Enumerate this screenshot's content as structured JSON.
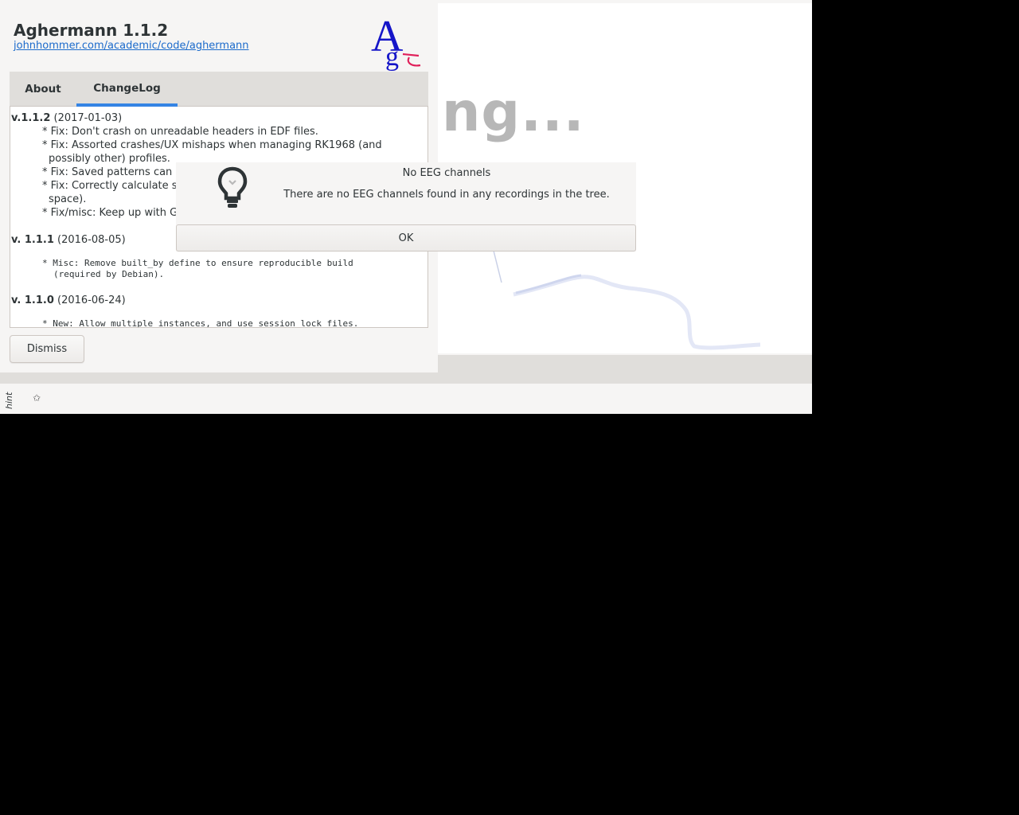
{
  "main_window": {
    "loading_text": "ng...",
    "status_hint_label": "hint",
    "status_icon": "star-icon"
  },
  "about_dialog": {
    "title": "Aghermann 1.1.2",
    "link": "johnhommer.com/academic/code/aghermann",
    "logo_text": "Ag",
    "tabs": [
      {
        "label": "About",
        "active": false
      },
      {
        "label": "ChangeLog",
        "active": true
      }
    ],
    "changelog": [
      {
        "version": "v.1.1.2",
        "date": "(2017-01-03)"
      },
      {
        "text": "* Fix: Don't crash on unreadable headers in EDF files."
      },
      {
        "text": "* Fix: Assorted crashes/UX mishaps when managing RK1968 (and"
      },
      {
        "text": "possibly other) profiles."
      },
      {
        "text": "* Fix: Saved patterns can"
      },
      {
        "text": "* Fix: Correctly calculate s"
      },
      {
        "text": "space)."
      },
      {
        "text": "* Fix/misc: Keep up with G"
      },
      {
        "version": "v. 1.1.1",
        "date": "(2016-08-05)"
      },
      {
        "text": "* Misc: Remove built_by define to ensure reproducible build"
      },
      {
        "text": "(required by Debian)."
      },
      {
        "version": "v. 1.1.0",
        "date": "(2016-06-24)"
      },
      {
        "text": "* New: Allow multiple instances, and use session lock files."
      }
    ],
    "dismiss_label": "Dismiss",
    "accent_color": "#3584e4",
    "link_color": "#1b6acb"
  },
  "message_dialog": {
    "icon": "lightbulb-icon",
    "title": "No EEG channels",
    "text": "There are no EEG channels found in any recordings in the tree.",
    "ok_label": "OK"
  }
}
